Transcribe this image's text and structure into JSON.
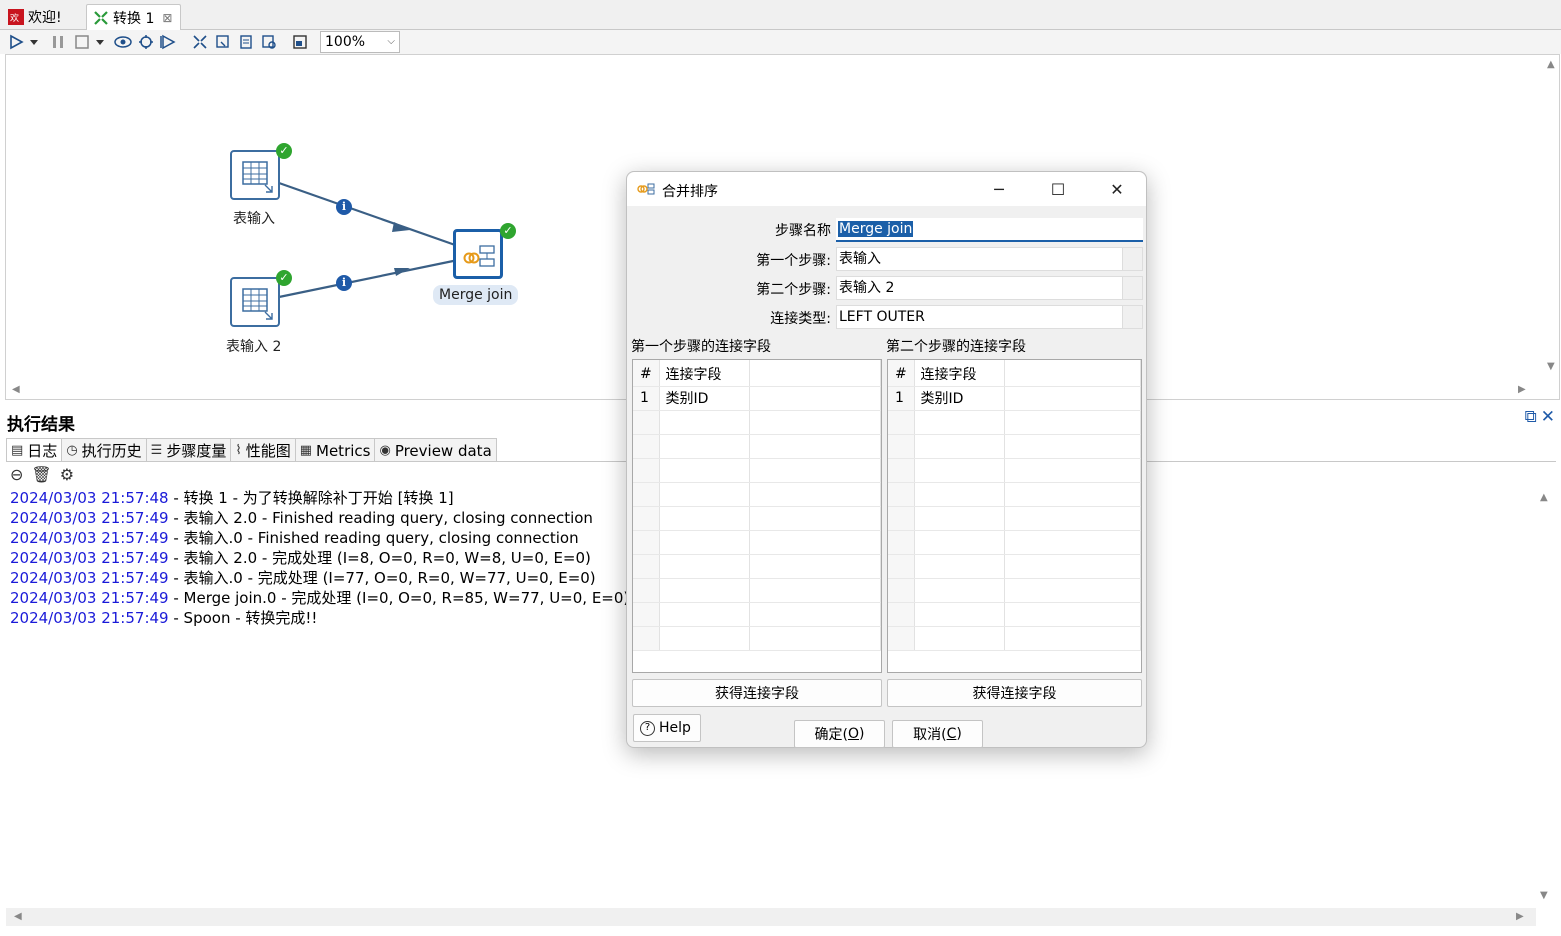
{
  "tabs": [
    {
      "label": "欢迎!",
      "icon": "spoon-logo-icon"
    },
    {
      "label": "转换 1",
      "icon": "transformation-icon",
      "close": "⊠"
    }
  ],
  "toolbar": {
    "zoom": "100%"
  },
  "canvas": {
    "steps": [
      {
        "label": "表输入"
      },
      {
        "label": "表输入 2"
      },
      {
        "label": "Merge join"
      }
    ]
  },
  "results": {
    "title": "执行结果",
    "tabs": [
      {
        "label": "日志",
        "icon": "log-icon"
      },
      {
        "label": "执行历史",
        "icon": "history-icon"
      },
      {
        "label": "步骤度量",
        "icon": "step-metrics-icon"
      },
      {
        "label": "性能图",
        "icon": "performance-chart-icon"
      },
      {
        "label": "Metrics",
        "icon": "metrics-icon"
      },
      {
        "label": "Preview data",
        "icon": "preview-eye-icon"
      }
    ],
    "log": [
      {
        "ts": "2024/03/03 21:57:48",
        "msg": " - 转换 1 - 为了转换解除补丁开始  [转换 1]"
      },
      {
        "ts": "2024/03/03 21:57:49",
        "msg": " - 表输入 2.0 - Finished reading query, closing connection"
      },
      {
        "ts": "2024/03/03 21:57:49",
        "msg": " - 表输入.0 - Finished reading query, closing connection"
      },
      {
        "ts": "2024/03/03 21:57:49",
        "msg": " - 表输入 2.0 - 完成处理 (I=8, O=0, R=0, W=8, U=0, E=0)"
      },
      {
        "ts": "2024/03/03 21:57:49",
        "msg": " - 表输入.0 - 完成处理 (I=77, O=0, R=0, W=77, U=0, E=0)"
      },
      {
        "ts": "2024/03/03 21:57:49",
        "msg": " - Merge join.0 - 完成处理 (I=0, O=0, R=85, W=77, U=0, E=0)"
      },
      {
        "ts": "2024/03/03 21:57:49",
        "msg": " - Spoon - 转换完成!!"
      }
    ]
  },
  "dialog": {
    "title": "合并排序",
    "fields": {
      "step_name_label": "步骤名称",
      "step_name_value": "Merge join",
      "first_step_label": "第一个步骤:",
      "first_step_value": "表输入",
      "second_step_label": "第二个步骤:",
      "second_step_value": "表输入 2",
      "join_type_label": "连接类型:",
      "join_type_value": "LEFT OUTER"
    },
    "left_grid": {
      "title": "第一个步骤的连接字段",
      "header": [
        "#",
        "连接字段"
      ],
      "rows": [
        [
          "1",
          "类别ID"
        ]
      ]
    },
    "right_grid": {
      "title": "第二个步骤的连接字段",
      "header": [
        "#",
        "连接字段"
      ],
      "rows": [
        [
          "1",
          "类别ID"
        ]
      ]
    },
    "get_fields_label": "获得连接字段",
    "help_label": "Help",
    "ok_label": "确定(",
    "ok_key": "O",
    "cancel_label": "取消(",
    "cancel_key": "C",
    "paren_close": ")"
  }
}
